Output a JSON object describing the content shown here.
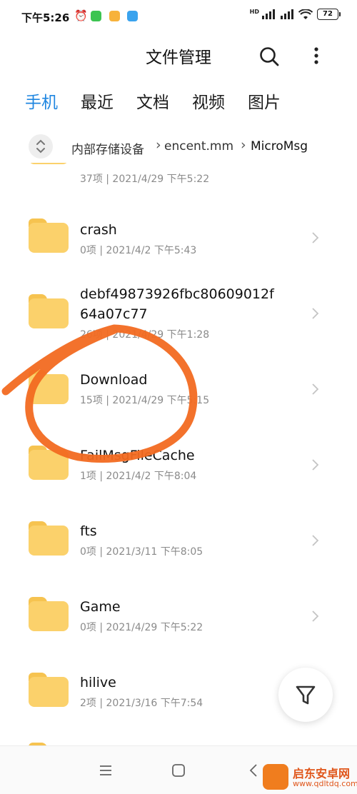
{
  "status_bar": {
    "time": "下午5:26",
    "network_badge": "HD",
    "battery": "72"
  },
  "header": {
    "title": "文件管理",
    "search_icon": "search-icon",
    "more_icon": "more-vertical-icon"
  },
  "tabs": [
    {
      "label": "手机",
      "active": true
    },
    {
      "label": "最近",
      "active": false
    },
    {
      "label": "文档",
      "active": false
    },
    {
      "label": "视频",
      "active": false
    },
    {
      "label": "图片",
      "active": false
    }
  ],
  "breadcrumb": {
    "root": "内部存储设备",
    "parent": "encent.mm",
    "current": "MicroMsg"
  },
  "folders": [
    {
      "name": "",
      "meta": "37项 | 2021/4/29 下午5:22"
    },
    {
      "name": "crash",
      "meta": "0项 | 2021/4/2 下午5:43"
    },
    {
      "name": "debf49873926fbc80609012f",
      "name2": "64a07c77",
      "meta": "26项 | 2021/4/29 下午1:28"
    },
    {
      "name": "Download",
      "meta": "15项 | 2021/4/29 下午5:15"
    },
    {
      "name": "FailMsgFileCache",
      "meta": "1项 | 2021/4/2 下午8:04"
    },
    {
      "name": "fts",
      "meta": "0项 | 2021/3/11 下午8:05"
    },
    {
      "name": "Game",
      "meta": "0项 | 2021/4/29 下午5:22"
    },
    {
      "name": "hilive",
      "meta": "2项 | 2021/3/16 下午7:54"
    }
  ],
  "fab_icon": "filter-icon",
  "nav": {
    "menu_icon": "menu-icon",
    "home_icon": "home-square-icon",
    "back_icon": "back-icon"
  },
  "colors": {
    "accent": "#1f86e0",
    "folder": "#fbd16b",
    "annotation": "#f26a21"
  },
  "watermark": {
    "name": "启东安卓网",
    "url": "www.qdltdq.com"
  }
}
